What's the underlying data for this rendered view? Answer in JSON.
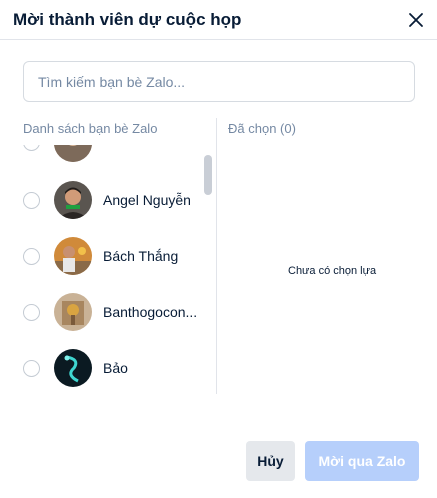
{
  "dialog": {
    "title": "Mời thành viên dự cuộc họp"
  },
  "search": {
    "placeholder": "Tìm kiếm bạn bè Zalo..."
  },
  "friends": {
    "title": "Danh sách bạn bè Zalo",
    "items": [
      {
        "name": "",
        "avatar": "partial-avatar"
      },
      {
        "name": "Angel Nguyễn",
        "avatar": "man-portrait-avatar"
      },
      {
        "name": "Bách Thắng",
        "avatar": "man-outdoor-avatar"
      },
      {
        "name": "Banthogocon...",
        "avatar": "altar-avatar"
      },
      {
        "name": "Bảo",
        "avatar": "dragon-avatar"
      }
    ]
  },
  "selected": {
    "title": "Đã chọn (0)",
    "empty_text": "Chưa có chọn lựa"
  },
  "buttons": {
    "cancel_label": "Hủy",
    "invite_label": "Mời qua Zalo"
  },
  "colors": {
    "primary_disabled": "#b6cffb",
    "muted_text": "#7589a3",
    "text": "#081c36"
  }
}
